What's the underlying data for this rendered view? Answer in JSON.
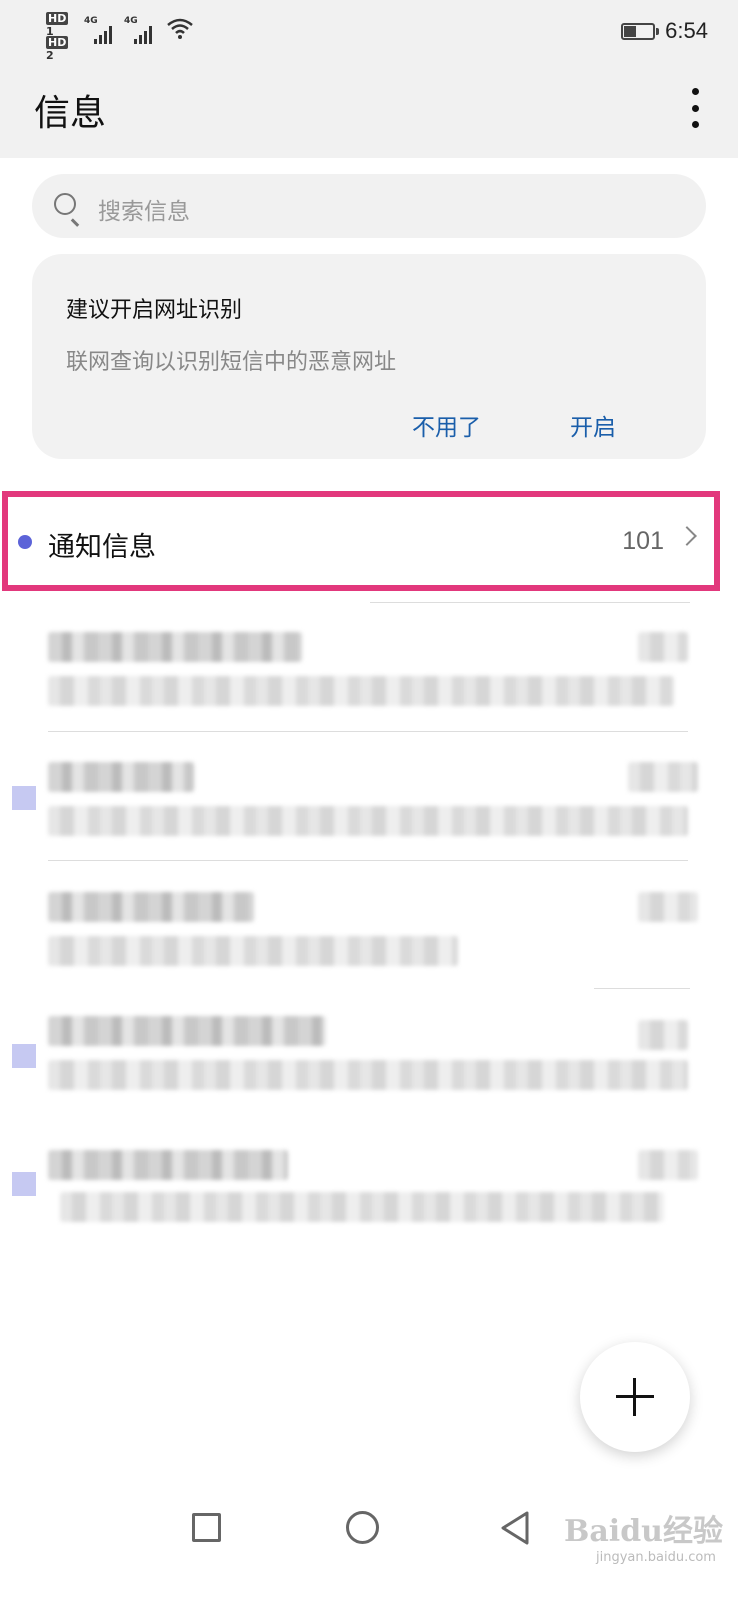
{
  "status_bar": {
    "sim1": "HD",
    "sim1_index": "1",
    "sim2": "HD",
    "sim2_index": "2",
    "network1": "4G",
    "network2": "4G",
    "time": "6:54",
    "battery_level": 0.4
  },
  "header": {
    "title": "信息",
    "more_icon": "more-vertical-icon"
  },
  "search": {
    "placeholder": "搜索信息",
    "icon": "search-icon"
  },
  "tip_card": {
    "title": "建议开启网址识别",
    "description": "联网查询以识别短信中的恶意网址",
    "dismiss_label": "不用了",
    "enable_label": "开启"
  },
  "notification_row": {
    "label": "通知信息",
    "count": "101",
    "dot_color": "#5c63d8",
    "highlight_color": "#e2387c"
  },
  "conversations": [
    {
      "unread": false
    },
    {
      "unread": true
    },
    {
      "unread": false
    },
    {
      "unread": true
    },
    {
      "unread": true
    }
  ],
  "fab": {
    "icon": "plus-icon"
  },
  "navigation_bar": {
    "recents_icon": "square-icon",
    "home_icon": "circle-icon",
    "back_icon": "back-triangle-icon"
  },
  "watermark": {
    "brand": "Baidu",
    "suffix": "经验",
    "url": "jingyan.baidu.com"
  }
}
